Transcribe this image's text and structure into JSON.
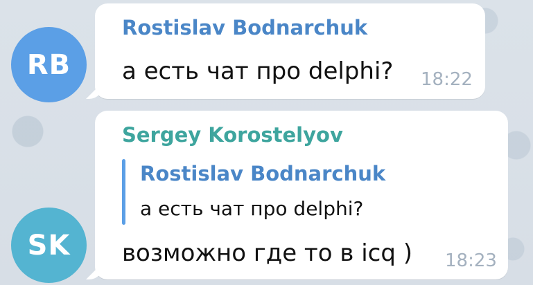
{
  "chat": {
    "messages": [
      {
        "avatar_initials": "RB",
        "sender": "Rostislav Bodnarchuk",
        "text": "а есть чат про delphi?",
        "time": "18:22"
      },
      {
        "avatar_initials": "SK",
        "sender": "Sergey Korostelyov",
        "reply": {
          "sender": "Rostislav Bodnarchuk",
          "text": "а есть чат про delphi?"
        },
        "text": "возможно где то в icq )",
        "time": "18:23"
      }
    ]
  },
  "colors": {
    "background": "#d9e0e8",
    "bubble": "#ffffff",
    "avatar_rb": "#5b9fe6",
    "avatar_sk": "#54b4d1",
    "sender_rb": "#4a86c7",
    "sender_sk": "#3ea59e",
    "time": "#a4b1bf"
  }
}
